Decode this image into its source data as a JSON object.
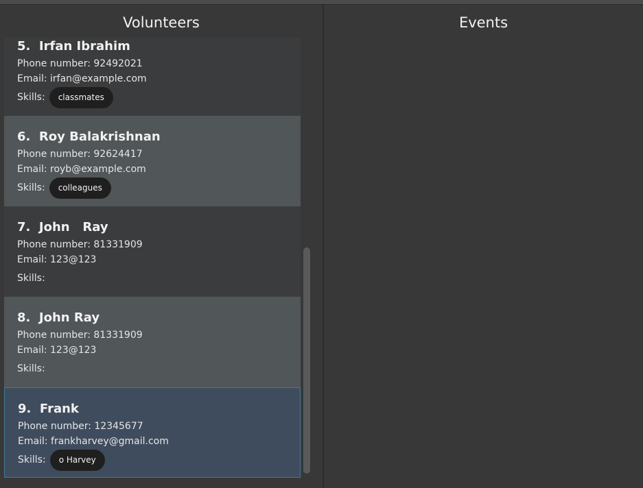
{
  "volunteers_panel": {
    "title": "Volunteers"
  },
  "events_panel": {
    "title": "Events"
  },
  "volunteers": [
    {
      "index": "5.",
      "name": "Irfan Ibrahim",
      "phone": "Phone number: 92492021",
      "email": "Email: irfan@example.com",
      "skills_label": "Skills:",
      "skills": [
        "classmates"
      ]
    },
    {
      "index": "6.",
      "name": "Roy Balakrishnan",
      "phone": "Phone number: 92624417",
      "email": "Email: royb@example.com",
      "skills_label": "Skills:",
      "skills": [
        "colleagues"
      ]
    },
    {
      "index": "7.",
      "name": "John   Ray",
      "phone": "Phone number: 81331909",
      "email": "Email: 123@123",
      "skills_label": "Skills:",
      "skills": []
    },
    {
      "index": "8.",
      "name": "John Ray",
      "phone": "Phone number: 81331909",
      "email": "Email: 123@123",
      "skills_label": "Skills:",
      "skills": []
    },
    {
      "index": "9.",
      "name": "Frank",
      "phone": "Phone number: 12345677",
      "email": "Email: frankharvey@gmail.com",
      "skills_label": "Skills:",
      "skills": [
        "o Harvey"
      ]
    }
  ],
  "selected_index": 4,
  "colors": {
    "background": "#383838",
    "card_odd": "#3b3c3d",
    "card_even": "#515658",
    "card_selected": "#3f4c5e",
    "tag_background": "#1f1f1f"
  }
}
